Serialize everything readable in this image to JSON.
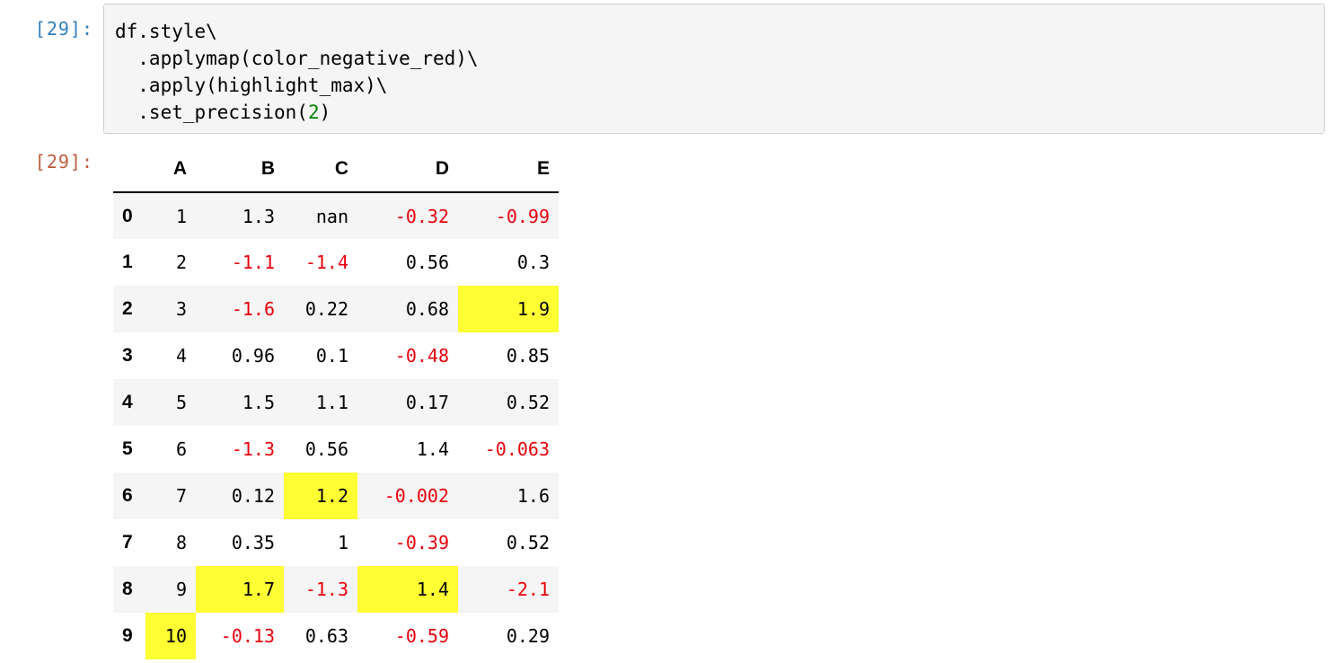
{
  "input_prompt": "[29]:",
  "output_prompt": "[29]:",
  "code": {
    "line1": "df.style\\",
    "line2": "  .applymap(color_negative_red)\\",
    "line3": "  .apply(highlight_max)\\",
    "line4_prefix": "  .set_precision(",
    "line4_number": "2",
    "line4_suffix": ")"
  },
  "table": {
    "columns": [
      "A",
      "B",
      "C",
      "D",
      "E"
    ],
    "rows": [
      {
        "index": "0",
        "cells": [
          {
            "v": "1",
            "neg": false,
            "max": false
          },
          {
            "v": "1.3",
            "neg": false,
            "max": false
          },
          {
            "v": "nan",
            "neg": false,
            "max": false
          },
          {
            "v": "-0.32",
            "neg": true,
            "max": false
          },
          {
            "v": "-0.99",
            "neg": true,
            "max": false
          }
        ]
      },
      {
        "index": "1",
        "cells": [
          {
            "v": "2",
            "neg": false,
            "max": false
          },
          {
            "v": "-1.1",
            "neg": true,
            "max": false
          },
          {
            "v": "-1.4",
            "neg": true,
            "max": false
          },
          {
            "v": "0.56",
            "neg": false,
            "max": false
          },
          {
            "v": "0.3",
            "neg": false,
            "max": false
          }
        ]
      },
      {
        "index": "2",
        "cells": [
          {
            "v": "3",
            "neg": false,
            "max": false
          },
          {
            "v": "-1.6",
            "neg": true,
            "max": false
          },
          {
            "v": "0.22",
            "neg": false,
            "max": false
          },
          {
            "v": "0.68",
            "neg": false,
            "max": false
          },
          {
            "v": "1.9",
            "neg": false,
            "max": true
          }
        ]
      },
      {
        "index": "3",
        "cells": [
          {
            "v": "4",
            "neg": false,
            "max": false
          },
          {
            "v": "0.96",
            "neg": false,
            "max": false
          },
          {
            "v": "0.1",
            "neg": false,
            "max": false
          },
          {
            "v": "-0.48",
            "neg": true,
            "max": false
          },
          {
            "v": "0.85",
            "neg": false,
            "max": false
          }
        ]
      },
      {
        "index": "4",
        "cells": [
          {
            "v": "5",
            "neg": false,
            "max": false
          },
          {
            "v": "1.5",
            "neg": false,
            "max": false
          },
          {
            "v": "1.1",
            "neg": false,
            "max": false
          },
          {
            "v": "0.17",
            "neg": false,
            "max": false
          },
          {
            "v": "0.52",
            "neg": false,
            "max": false
          }
        ]
      },
      {
        "index": "5",
        "cells": [
          {
            "v": "6",
            "neg": false,
            "max": false
          },
          {
            "v": "-1.3",
            "neg": true,
            "max": false
          },
          {
            "v": "0.56",
            "neg": false,
            "max": false
          },
          {
            "v": "1.4",
            "neg": false,
            "max": false
          },
          {
            "v": "-0.063",
            "neg": true,
            "max": false
          }
        ]
      },
      {
        "index": "6",
        "cells": [
          {
            "v": "7",
            "neg": false,
            "max": false
          },
          {
            "v": "0.12",
            "neg": false,
            "max": false
          },
          {
            "v": "1.2",
            "neg": false,
            "max": true
          },
          {
            "v": "-0.002",
            "neg": true,
            "max": false
          },
          {
            "v": "1.6",
            "neg": false,
            "max": false
          }
        ]
      },
      {
        "index": "7",
        "cells": [
          {
            "v": "8",
            "neg": false,
            "max": false
          },
          {
            "v": "0.35",
            "neg": false,
            "max": false
          },
          {
            "v": "1",
            "neg": false,
            "max": false
          },
          {
            "v": "-0.39",
            "neg": true,
            "max": false
          },
          {
            "v": "0.52",
            "neg": false,
            "max": false
          }
        ]
      },
      {
        "index": "8",
        "cells": [
          {
            "v": "9",
            "neg": false,
            "max": false
          },
          {
            "v": "1.7",
            "neg": false,
            "max": true
          },
          {
            "v": "-1.3",
            "neg": true,
            "max": false
          },
          {
            "v": "1.4",
            "neg": false,
            "max": true
          },
          {
            "v": "-2.1",
            "neg": true,
            "max": false
          }
        ]
      },
      {
        "index": "9",
        "cells": [
          {
            "v": "10",
            "neg": false,
            "max": true
          },
          {
            "v": "-0.13",
            "neg": true,
            "max": false
          },
          {
            "v": "0.63",
            "neg": false,
            "max": false
          },
          {
            "v": "-0.59",
            "neg": true,
            "max": false
          },
          {
            "v": "0.29",
            "neg": false,
            "max": false
          }
        ]
      }
    ]
  },
  "colors": {
    "negative": "#e8000b",
    "highlight": "#ffff33",
    "input_prompt": "#307fc1",
    "output_prompt": "#bf5b3d"
  }
}
